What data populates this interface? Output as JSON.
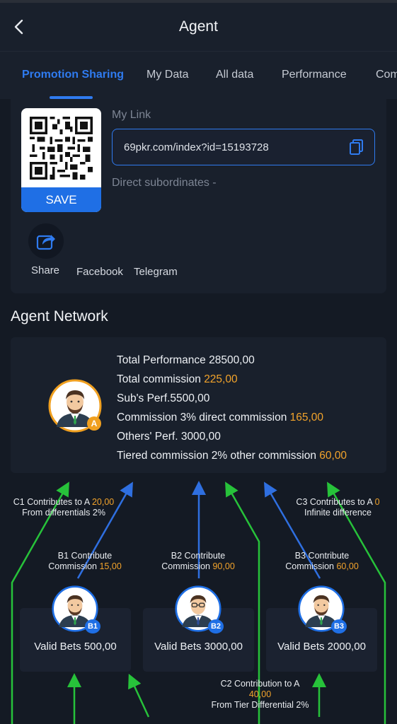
{
  "header": {
    "title": "Agent"
  },
  "tabs": [
    "Promotion Sharing",
    "My Data",
    "All data",
    "Performance",
    "Com"
  ],
  "share": {
    "save_label": "SAVE",
    "my_link_label": "My Link",
    "link_value": "69pkr.com/index?id=15193728",
    "direct_subordinates_label": "Direct subordinates -",
    "share_label": "Share",
    "facebook_label": "Facebook",
    "telegram_label": "Telegram"
  },
  "network": {
    "title": "Agent Network",
    "badge": "A",
    "total_performance": "Total Performance 28500,00",
    "total_commission_label": "Total commission ",
    "total_commission_value": "225,00",
    "subs_perf": "Sub's Perf.5500,00",
    "commission_direct_label": "Commission 3% direct commission ",
    "commission_direct_value": "165,00",
    "others_perf": "Others' Perf. 3000,00",
    "tiered_label": "Tiered commission 2% other commission ",
    "tiered_value": "60,00"
  },
  "diagram": {
    "c1_label": "C1 Contributes to A ",
    "c1_value": "20,00",
    "c1_sub": "From differentials 2%",
    "c3_label": "C3 Contributes to A ",
    "c3_value": "0",
    "c3_sub": "Infinite difference",
    "b1_line1": "B1 Contribute",
    "b1_line2": "Commission ",
    "b1_value": "15,00",
    "b2_line1": "B2 Contribute",
    "b2_line2": "Commission ",
    "b2_value": "90,00",
    "b3_line1": "B3 Contribute",
    "b3_line2": "Commission ",
    "b3_value": "60,00",
    "c2_line1": "C2 Contribution to A",
    "c2_value": "40,00",
    "c2_sub": "From Tier Differential 2%",
    "cards": [
      {
        "badge": "B1",
        "bets": "Valid Bets 500,00"
      },
      {
        "badge": "B2",
        "bets": "Valid Bets 3000,00"
      },
      {
        "badge": "B3",
        "bets": "Valid Bets 2000,00"
      }
    ]
  },
  "colors": {
    "accent": "#2f7bf0",
    "highlight": "#f2a32b",
    "green_arrow": "#27c23a",
    "blue_arrow": "#2f6fe0"
  }
}
